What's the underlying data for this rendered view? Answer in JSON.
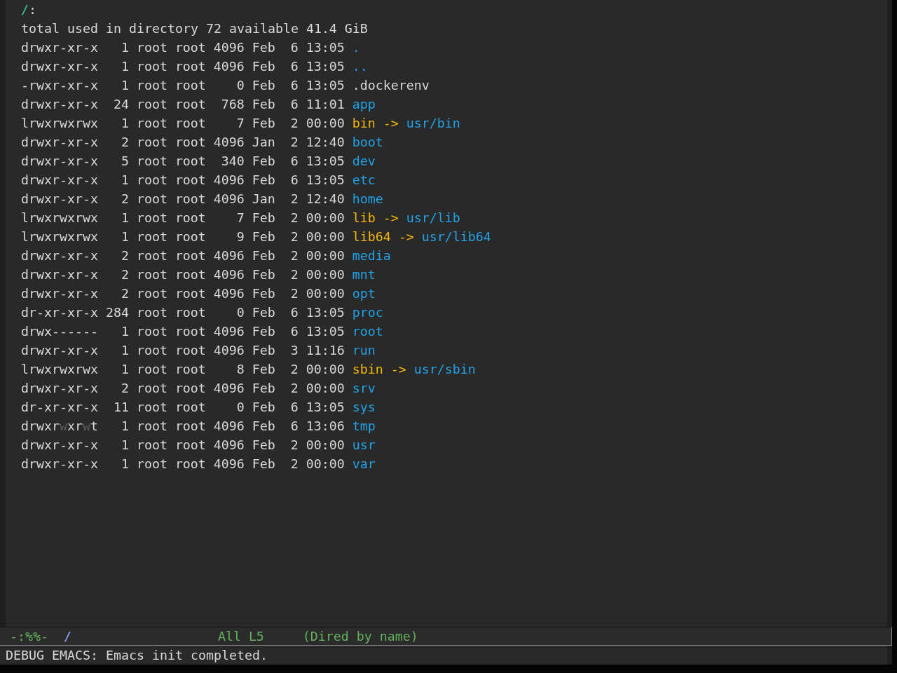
{
  "buffer": {
    "header": {
      "path": "/",
      "colon": ":"
    },
    "summary": "total used in directory 72 available 41.4 GiB",
    "entries": [
      {
        "kind": "directory",
        "permissions": [
          {
            "text": "drwxr-xr-x",
            "dim": false
          }
        ],
        "links": "1",
        "owner": "root",
        "group": "root",
        "size": "4096",
        "month": "Feb",
        "day": "6",
        "time": "13:05",
        "name": "."
      },
      {
        "kind": "directory",
        "permissions": [
          {
            "text": "drwxr-xr-x",
            "dim": false
          }
        ],
        "links": "1",
        "owner": "root",
        "group": "root",
        "size": "4096",
        "month": "Feb",
        "day": "6",
        "time": "13:05",
        "name": ".."
      },
      {
        "kind": "file",
        "permissions": [
          {
            "text": "-rwxr-xr-x",
            "dim": false
          }
        ],
        "links": "1",
        "owner": "root",
        "group": "root",
        "size": "0",
        "month": "Feb",
        "day": "6",
        "time": "13:05",
        "name": ".dockerenv"
      },
      {
        "kind": "directory",
        "permissions": [
          {
            "text": "drwxr-xr-x",
            "dim": false
          }
        ],
        "links": "24",
        "owner": "root",
        "group": "root",
        "size": "768",
        "month": "Feb",
        "day": "6",
        "time": "11:01",
        "name": "app"
      },
      {
        "kind": "symlink",
        "permissions": [
          {
            "text": "lrwxrwxrwx",
            "dim": false
          }
        ],
        "links": "1",
        "owner": "root",
        "group": "root",
        "size": "7",
        "month": "Feb",
        "day": "2",
        "time": "00:00",
        "name": "bin",
        "arrow": "->",
        "target": "usr/bin"
      },
      {
        "kind": "directory",
        "permissions": [
          {
            "text": "drwxr-xr-x",
            "dim": false
          }
        ],
        "links": "2",
        "owner": "root",
        "group": "root",
        "size": "4096",
        "month": "Jan",
        "day": "2",
        "time": "12:40",
        "name": "boot"
      },
      {
        "kind": "directory",
        "permissions": [
          {
            "text": "drwxr-xr-x",
            "dim": false
          }
        ],
        "links": "5",
        "owner": "root",
        "group": "root",
        "size": "340",
        "month": "Feb",
        "day": "6",
        "time": "13:05",
        "name": "dev"
      },
      {
        "kind": "directory",
        "permissions": [
          {
            "text": "drwxr-xr-x",
            "dim": false
          }
        ],
        "links": "1",
        "owner": "root",
        "group": "root",
        "size": "4096",
        "month": "Feb",
        "day": "6",
        "time": "13:05",
        "name": "etc"
      },
      {
        "kind": "directory",
        "permissions": [
          {
            "text": "drwxr-xr-x",
            "dim": false
          }
        ],
        "links": "2",
        "owner": "root",
        "group": "root",
        "size": "4096",
        "month": "Jan",
        "day": "2",
        "time": "12:40",
        "name": "home"
      },
      {
        "kind": "symlink",
        "permissions": [
          {
            "text": "lrwxrwxrwx",
            "dim": false
          }
        ],
        "links": "1",
        "owner": "root",
        "group": "root",
        "size": "7",
        "month": "Feb",
        "day": "2",
        "time": "00:00",
        "name": "lib",
        "arrow": "->",
        "target": "usr/lib"
      },
      {
        "kind": "symlink",
        "permissions": [
          {
            "text": "lrwxrwxrwx",
            "dim": false
          }
        ],
        "links": "1",
        "owner": "root",
        "group": "root",
        "size": "9",
        "month": "Feb",
        "day": "2",
        "time": "00:00",
        "name": "lib64",
        "arrow": "->",
        "target": "usr/lib64"
      },
      {
        "kind": "directory",
        "permissions": [
          {
            "text": "drwxr-xr-x",
            "dim": false
          }
        ],
        "links": "2",
        "owner": "root",
        "group": "root",
        "size": "4096",
        "month": "Feb",
        "day": "2",
        "time": "00:00",
        "name": "media"
      },
      {
        "kind": "directory",
        "permissions": [
          {
            "text": "drwxr-xr-x",
            "dim": false
          }
        ],
        "links": "2",
        "owner": "root",
        "group": "root",
        "size": "4096",
        "month": "Feb",
        "day": "2",
        "time": "00:00",
        "name": "mnt"
      },
      {
        "kind": "directory",
        "permissions": [
          {
            "text": "drwxr-xr-x",
            "dim": false
          }
        ],
        "links": "2",
        "owner": "root",
        "group": "root",
        "size": "4096",
        "month": "Feb",
        "day": "2",
        "time": "00:00",
        "name": "opt"
      },
      {
        "kind": "directory",
        "permissions": [
          {
            "text": "dr-xr-xr-x",
            "dim": false
          }
        ],
        "links": "284",
        "owner": "root",
        "group": "root",
        "size": "0",
        "month": "Feb",
        "day": "6",
        "time": "13:05",
        "name": "proc"
      },
      {
        "kind": "directory",
        "permissions": [
          {
            "text": "drwx------",
            "dim": false
          }
        ],
        "links": "1",
        "owner": "root",
        "group": "root",
        "size": "4096",
        "month": "Feb",
        "day": "6",
        "time": "13:05",
        "name": "root"
      },
      {
        "kind": "directory",
        "permissions": [
          {
            "text": "drwxr-xr-x",
            "dim": false
          }
        ],
        "links": "1",
        "owner": "root",
        "group": "root",
        "size": "4096",
        "month": "Feb",
        "day": "3",
        "time": "11:16",
        "name": "run"
      },
      {
        "kind": "symlink",
        "permissions": [
          {
            "text": "lrwxrwxrwx",
            "dim": false
          }
        ],
        "links": "1",
        "owner": "root",
        "group": "root",
        "size": "8",
        "month": "Feb",
        "day": "2",
        "time": "00:00",
        "name": "sbin",
        "arrow": "->",
        "target": "usr/sbin"
      },
      {
        "kind": "directory",
        "permissions": [
          {
            "text": "drwxr-xr-x",
            "dim": false
          }
        ],
        "links": "2",
        "owner": "root",
        "group": "root",
        "size": "4096",
        "month": "Feb",
        "day": "2",
        "time": "00:00",
        "name": "srv"
      },
      {
        "kind": "directory",
        "permissions": [
          {
            "text": "dr-xr-xr-x",
            "dim": false
          }
        ],
        "links": "11",
        "owner": "root",
        "group": "root",
        "size": "0",
        "month": "Feb",
        "day": "6",
        "time": "13:05",
        "name": "sys"
      },
      {
        "kind": "directory",
        "permissions": [
          {
            "text": "drwxr",
            "dim": false
          },
          {
            "text": "w",
            "dim": true
          },
          {
            "text": "xr",
            "dim": false
          },
          {
            "text": "w",
            "dim": true
          },
          {
            "text": "t",
            "dim": false
          }
        ],
        "links": "1",
        "owner": "root",
        "group": "root",
        "size": "4096",
        "month": "Feb",
        "day": "6",
        "time": "13:06",
        "name": "tmp"
      },
      {
        "kind": "directory",
        "permissions": [
          {
            "text": "drwxr-xr-x",
            "dim": false
          }
        ],
        "links": "1",
        "owner": "root",
        "group": "root",
        "size": "4096",
        "month": "Feb",
        "day": "2",
        "time": "00:00",
        "name": "usr"
      },
      {
        "kind": "directory",
        "permissions": [
          {
            "text": "drwxr-xr-x",
            "dim": false
          }
        ],
        "links": "1",
        "owner": "root",
        "group": "root",
        "size": "4096",
        "month": "Feb",
        "day": "2",
        "time": "00:00",
        "name": "var"
      }
    ]
  },
  "mode_line": {
    "status": "-:%%-",
    "buffer_name": "/",
    "position": "All L5",
    "mode": "(Dired by name)"
  },
  "echo_area": {
    "message": "DEBUG EMACS: Emacs init completed."
  }
}
